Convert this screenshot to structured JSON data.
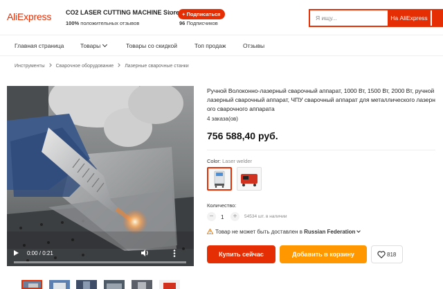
{
  "header": {
    "logo": "AliExpress",
    "store_name": "CO2 LASER CUTTING MACHINE Store",
    "positive_pct": "100%",
    "positive_text": "положительных отзывов",
    "subscribe_label": "+ Подписаться",
    "subscribers_count": "96",
    "subscribers_text": "Подписчиков",
    "search_placeholder": "Я ищу...",
    "search_button": "На AliExpress"
  },
  "nav": {
    "items": [
      "Главная страница",
      "Товары",
      "Товары со скидкой",
      "Топ продаж",
      "Отзывы"
    ]
  },
  "breadcrumb": [
    "Инструменты",
    "Сварочное оборудование",
    "Лазерные сварочные станки"
  ],
  "video": {
    "time": "0:00 / 0:21",
    "progress": 0
  },
  "product": {
    "title": "Ручной Волоконно-лазерный сварочный аппарат, 1000 Вт, 1500 Вт, 2000 Вт, ручной лазерный сварочный аппарат, ЧПУ сварочный аппарат для металлического лазерного сварочного аппарата",
    "orders": "4 заказа(ов)",
    "price": "756 588,40 руб.",
    "color_label": "Color:",
    "color_value": "Laser welder",
    "qty_label": "Количество:",
    "qty_value": "1",
    "stock": "54534 шт. в наличии",
    "ship_text": "Товар не может быть доставлен в",
    "ship_country": "Russian Federation",
    "buy_now": "Купить сейчас",
    "add_to_cart": "Добавить в корзину",
    "wishlist_count": "818"
  },
  "colors": {
    "brand": "#e62e04",
    "cart": "#ff9800"
  }
}
